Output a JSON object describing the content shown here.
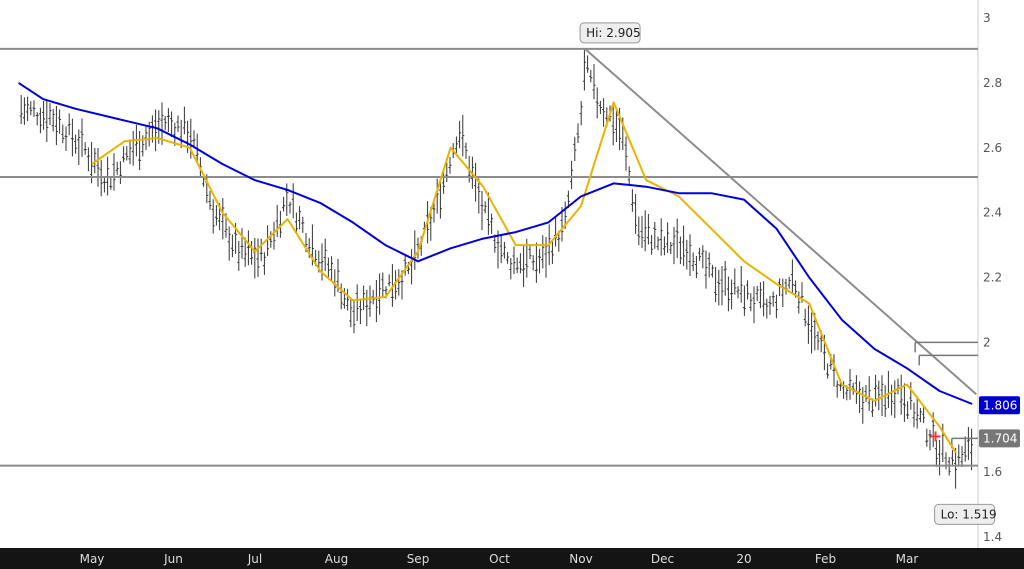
{
  "chart_data": {
    "type": "line",
    "style": "ohlc-bars",
    "x_unit": "month",
    "x_tick_labels": [
      "May",
      "Jun",
      "Jul",
      "Aug",
      "Sep",
      "Oct",
      "Nov",
      "Dec",
      "20",
      "Feb",
      "Mar"
    ],
    "y_tick_labels": [
      "1.4",
      "1.6",
      "1.8",
      "2",
      "2.2",
      "2.4",
      "2.6",
      "2.8",
      "3"
    ],
    "ylim": [
      1.4,
      3.0
    ],
    "y_axis_side": "right",
    "grid": false,
    "series": [
      {
        "key": "ma_fast",
        "color": "#e8b400",
        "x": [
          0.0,
          0.4,
          0.8,
          1.2,
          1.6,
          2.0,
          2.4,
          2.8,
          3.2,
          3.6,
          4.0,
          4.4,
          4.8,
          5.2,
          5.6,
          6.0,
          6.4,
          6.8,
          7.2,
          7.6,
          8.0,
          8.4,
          8.8,
          9.2,
          9.6,
          10.0,
          10.4,
          10.6
        ],
        "values": [
          2.55,
          2.62,
          2.63,
          2.6,
          2.4,
          2.28,
          2.38,
          2.22,
          2.13,
          2.14,
          2.28,
          2.6,
          2.48,
          2.3,
          2.3,
          2.42,
          2.74,
          2.5,
          2.45,
          2.35,
          2.25,
          2.18,
          2.12,
          1.87,
          1.82,
          1.87,
          1.74,
          1.66
        ]
      },
      {
        "key": "ma_slow",
        "color": "#0000dd",
        "x": [
          -0.9,
          -0.6,
          -0.2,
          0.3,
          0.8,
          1.2,
          1.6,
          2.0,
          2.4,
          2.8,
          3.2,
          3.6,
          4.0,
          4.4,
          4.8,
          5.2,
          5.6,
          6.0,
          6.4,
          6.8,
          7.2,
          7.6,
          8.0,
          8.4,
          8.8,
          9.2,
          9.6,
          10.0,
          10.4,
          10.8
        ],
        "values": [
          2.8,
          2.75,
          2.72,
          2.69,
          2.66,
          2.61,
          2.55,
          2.5,
          2.47,
          2.43,
          2.37,
          2.3,
          2.25,
          2.29,
          2.32,
          2.34,
          2.37,
          2.45,
          2.49,
          2.48,
          2.46,
          2.46,
          2.44,
          2.35,
          2.2,
          2.07,
          1.98,
          1.92,
          1.85,
          1.81
        ]
      }
    ],
    "price_bars_path": [
      [
        -0.9,
        2.72
      ],
      [
        -0.5,
        2.7
      ],
      [
        -0.1,
        2.6
      ],
      [
        0.2,
        2.5
      ],
      [
        0.5,
        2.6
      ],
      [
        0.9,
        2.68
      ],
      [
        1.2,
        2.65
      ],
      [
        1.5,
        2.4
      ],
      [
        1.8,
        2.28
      ],
      [
        2.1,
        2.26
      ],
      [
        2.4,
        2.45
      ],
      [
        2.7,
        2.3
      ],
      [
        3.0,
        2.2
      ],
      [
        3.2,
        2.08
      ],
      [
        3.5,
        2.16
      ],
      [
        3.9,
        2.22
      ],
      [
        4.2,
        2.4
      ],
      [
        4.5,
        2.66
      ],
      [
        4.8,
        2.4
      ],
      [
        5.1,
        2.25
      ],
      [
        5.5,
        2.25
      ],
      [
        5.8,
        2.36
      ],
      [
        6.0,
        2.7
      ],
      [
        6.05,
        2.85
      ],
      [
        6.2,
        2.75
      ],
      [
        6.5,
        2.65
      ],
      [
        6.7,
        2.35
      ],
      [
        7.0,
        2.3
      ],
      [
        7.3,
        2.3
      ],
      [
        7.6,
        2.2
      ],
      [
        8.0,
        2.15
      ],
      [
        8.3,
        2.1
      ],
      [
        8.6,
        2.2
      ],
      [
        8.9,
        2.0
      ],
      [
        9.2,
        1.85
      ],
      [
        9.6,
        1.82
      ],
      [
        9.9,
        1.86
      ],
      [
        10.2,
        1.75
      ],
      [
        10.4,
        1.67
      ],
      [
        10.6,
        1.63
      ],
      [
        10.8,
        1.68
      ]
    ],
    "reference_lines": [
      {
        "key": "resistance_high",
        "value": 2.905,
        "color": "#8c8c8c"
      },
      {
        "key": "mid_level",
        "value": 2.51,
        "color": "#8c8c8c"
      },
      {
        "key": "support_low",
        "value": 1.62,
        "color": "#8c8c8c"
      }
    ],
    "trendline": {
      "from": [
        6.05,
        2.905
      ],
      "to": [
        10.85,
        1.84
      ],
      "color": "#8c8c8c"
    },
    "step_marks": [
      {
        "x_from": 10.1,
        "value": 2.0
      },
      {
        "x_from": 10.15,
        "value": 1.96
      },
      {
        "x_from": 10.55,
        "value": 1.704
      }
    ],
    "annotations": [
      {
        "key": "high",
        "text": "Hi: 2.905",
        "x": 6.05,
        "value": 2.905
      },
      {
        "key": "low",
        "text": "Lo: 1.519",
        "x": 10.4,
        "value": 1.519
      }
    ],
    "price_badges": [
      {
        "key": "ma_slow_last",
        "text": "1.806",
        "value": 1.806,
        "color": "#0000cc"
      },
      {
        "key": "last_price",
        "text": "1.704",
        "value": 1.704,
        "color": "#777777"
      }
    ],
    "cursor_mark": {
      "x": 10.35,
      "value": 1.71,
      "color": "#ff3333"
    }
  }
}
